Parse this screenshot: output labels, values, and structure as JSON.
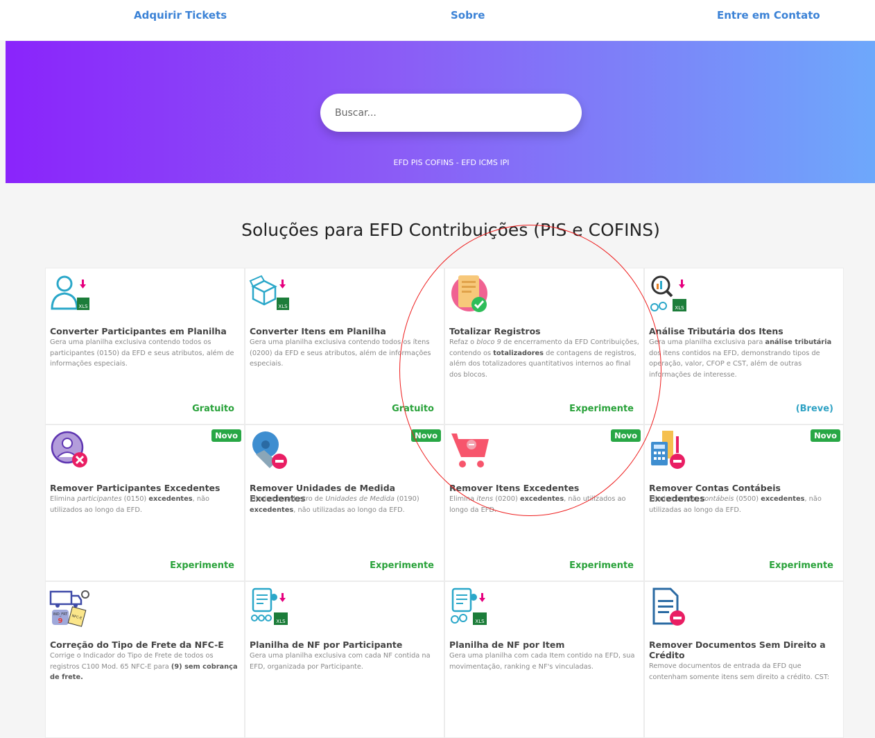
{
  "nav": {
    "tickets": "Adquirir Tickets",
    "about": "Sobre",
    "contact": "Entre em Contato"
  },
  "hero": {
    "search_placeholder": "Buscar...",
    "subtitle": "EFD PIS COFINS - EFD ICMS IPI"
  },
  "section": {
    "title": "Soluções para EFD Contribuições (PIS e COFINS)"
  },
  "colors": {
    "nav_link": "#3b82d6",
    "gradient_start": "#8a24fb",
    "gradient_end": "#6ea8fb",
    "green": "#29a23a",
    "blue_soon": "#2fa2c4",
    "badge": "#28a745",
    "annotation_circle": "#ee1c1c"
  },
  "cards": [
    {
      "icon": "person-xls-icon",
      "title": "Converter Participantes em Planilha",
      "desc": "Gera uma planilha exclusiva contendo todos os participantes (0150) da EFD e seus atributos, além de informações especiais.",
      "footer": "Gratuito",
      "badge": ""
    },
    {
      "icon": "box-xls-icon",
      "title": "Converter Itens em Planilha",
      "desc": "Gera uma planilha exclusiva contendo todos os ítens (0200) da EFD e seus atributos, além de informações especiais.",
      "footer": "Gratuito",
      "badge": ""
    },
    {
      "icon": "document-check-icon",
      "title": "Totalizar Registros",
      "desc": "Refaz o bloco 9 de encerramento da EFD Contribuições, contendo os totalizadores de contagens de registros, além dos totalizadores quantitativos internos ao final dos blocos.",
      "footer": "Experimente",
      "badge": ""
    },
    {
      "icon": "magnifier-chart-xls-icon",
      "title": "Análise Tributária dos Itens",
      "desc": "Gera uma planilha exclusiva para análise tributária dos itens contidos na EFD, demonstrando tipos de operação, valor, CFOP e CST, além de outras informações de interesse.",
      "footer": "(Breve)",
      "badge": ""
    },
    {
      "icon": "person-remove-icon",
      "title": "Remover Participantes Excedentes",
      "desc": "Elimina participantes (0150) excedentes, não utilizados ao longo da EFD.",
      "footer": "Experimente",
      "badge": "Novo"
    },
    {
      "icon": "tape-measure-remove-icon",
      "title": "Remover Unidades de Medida Excedentes",
      "desc": "Elimina o cadastro de Unidades de Medida (0190) excedentes, não utilizadas ao longo da EFD.",
      "footer": "Experimente",
      "badge": "Novo"
    },
    {
      "icon": "cart-remove-icon",
      "title": "Remover Itens Excedentes",
      "desc": "Elimina itens (0200) excedentes, não utilizados ao longo da EFD.",
      "footer": "Experimente",
      "badge": "Novo"
    },
    {
      "icon": "calculator-remove-icon",
      "title": "Remover Contas Contábeis Excedentes",
      "desc": "Elimina contas contábeis (0500) excedentes, não utilizadas ao longo da EFD.",
      "footer": "Experimente",
      "badge": "Novo"
    },
    {
      "icon": "truck-nfce-icon",
      "title": "Correção do Tipo de Frete da NFC-E",
      "desc": "Corrige o Indicador do Tipo de Frete de todos os registros C100 Mod. 65 NFC-E para (9) sem cobrança de frete.",
      "footer": "",
      "badge": "",
      "icon_text": {
        "ind": "IND_FRT",
        "num": "9",
        "nfce": "NFC-E"
      }
    },
    {
      "icon": "invoice-people-xls-icon",
      "title": "Planilha de NF por Participante",
      "desc": "Gera uma planilha exclusiva com cada NF contida na EFD, organizada por Participante.",
      "footer": "",
      "badge": ""
    },
    {
      "icon": "invoice-items-xls-icon",
      "title": "Planilha de NF por Item",
      "desc": "Gera uma planilha com cada Item contido na EFD, sua movimentação, ranking e NF's vinculadas.",
      "footer": "",
      "badge": ""
    },
    {
      "icon": "document-remove-icon",
      "title": "Remover Documentos Sem Direito a Crédito",
      "desc": "Remove documentos de entrada da EFD que contenham somente itens sem direito a crédito. CST:",
      "footer": "",
      "badge": ""
    }
  ],
  "xls_label": "XLS"
}
